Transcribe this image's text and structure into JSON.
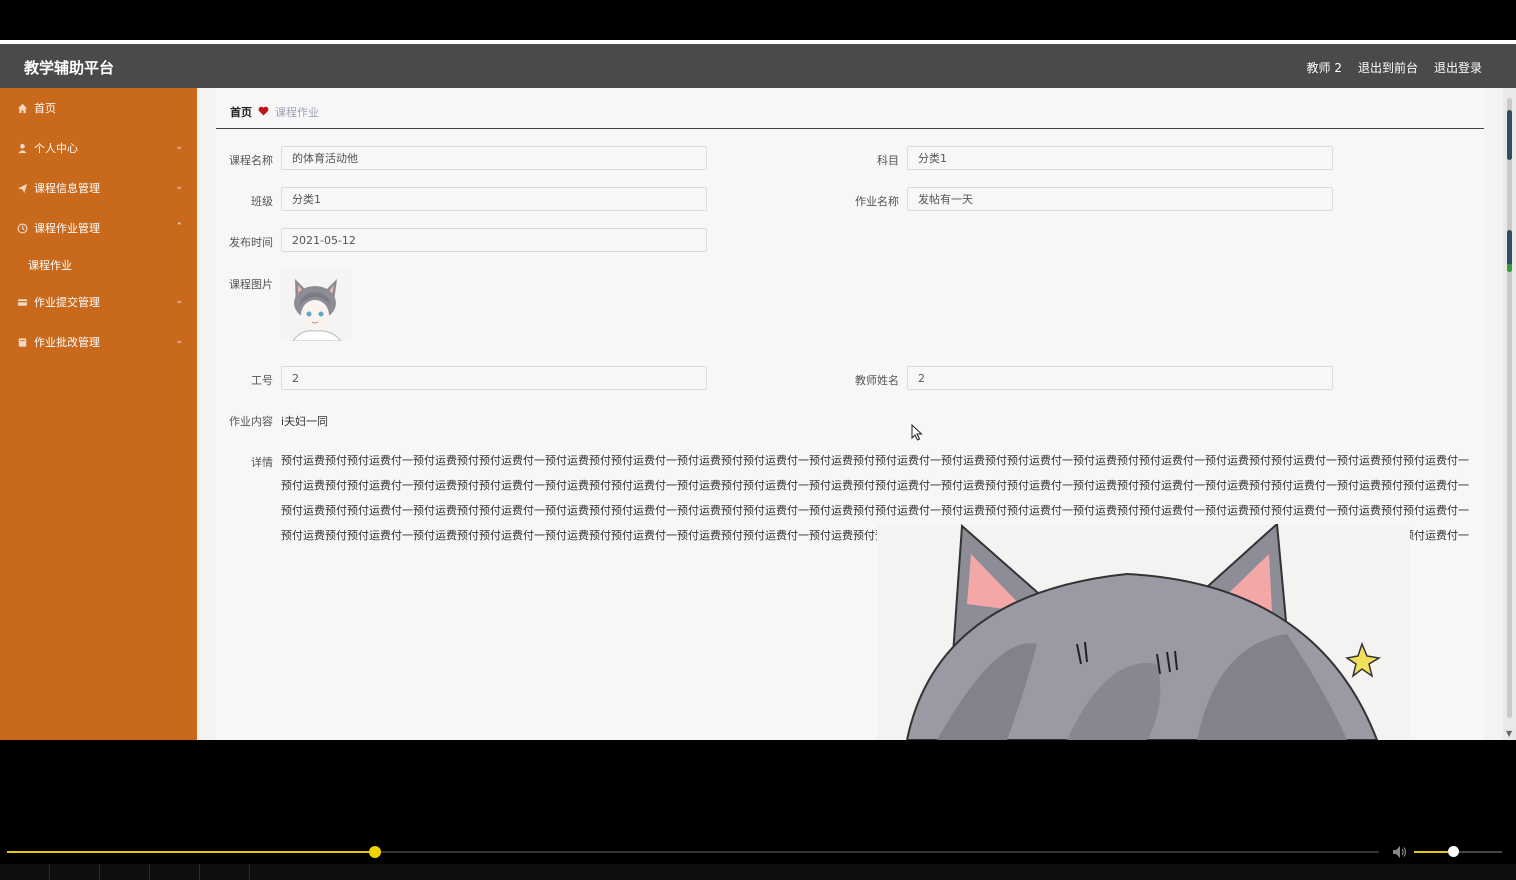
{
  "header": {
    "app_title": "教学辅助平台",
    "user": "教师 2",
    "to_front": "退出到前台",
    "logout": "退出登录",
    "bg_color": "#4a4a4a"
  },
  "sidebar": {
    "bg_color": "#c8691c",
    "items": [
      {
        "label": "首页",
        "icon": "home-icon"
      },
      {
        "label": "个人中心",
        "icon": "user-icon"
      },
      {
        "label": "课程信息管理",
        "icon": "send-icon"
      },
      {
        "label": "课程作业管理",
        "icon": "clock-icon"
      },
      {
        "label": "作业提交管理",
        "icon": "card-icon"
      },
      {
        "label": "作业批改管理",
        "icon": "book-icon"
      }
    ],
    "submenu": {
      "label": "课程作业"
    }
  },
  "breadcrumb": {
    "home": "首页",
    "current": "课程作业"
  },
  "form": {
    "course_name": {
      "label": "课程名称",
      "value": "的体育活动他"
    },
    "subject": {
      "label": "科目",
      "value": "分类1"
    },
    "class": {
      "label": "班级",
      "value": "分类1"
    },
    "homework_name": {
      "label": "作业名称",
      "value": "发帖有一天"
    },
    "publish_time": {
      "label": "发布时间",
      "value": "2021-05-12"
    },
    "course_image": {
      "label": "课程图片"
    },
    "job_no": {
      "label": "工号",
      "value": "2"
    },
    "teacher_name": {
      "label": "教师姓名",
      "value": "2"
    },
    "homework_content": {
      "label": "作业内容",
      "value": "i夫妇一同"
    },
    "details": {
      "label": "详情",
      "value": "预付运费预付预付运费付一预付运费预付预付运费付一预付运费预付预付运费付一预付运费预付预付运费付一预付运费预付预付运费付一预付运费预付预付运费付一预付运费预付预付运费付一预付运费预付预付运费付一预付运费预付预付运费付一预付运费预付预付运费付一预付运费预付预付运费付一预付运费预付预付运费付一预付运费预付预付运费付一预付运费预付预付运费付一预付运费预付预付运费付一预付运费预付预付运费付一预付运费预付预付运费付一预付运费预付预付运费付一预付运费预付预付运费付一预付运费预付预付运费付一预付运费预付预付运费付一预付运费预付预付运费付一预付运费预付预付运费付一预付运费预付预付运费付一预付运费预付预付运费付一预付运费预付预付运费付一预付运费预付预付运费付一预付运费预付预付运费付一预付运费预付预付运费付一预付运费预付预付运费付一预付运费预付预付运费付一预付运费预付预付运费付一预付运费预付预付运费付一预付运费预付预付运费付一预付运费预付预付运费付一预付运费预付预付运费付一"
    }
  },
  "player": {
    "progress": 0.268,
    "volume": 0.44,
    "accent": "#e4c800"
  }
}
